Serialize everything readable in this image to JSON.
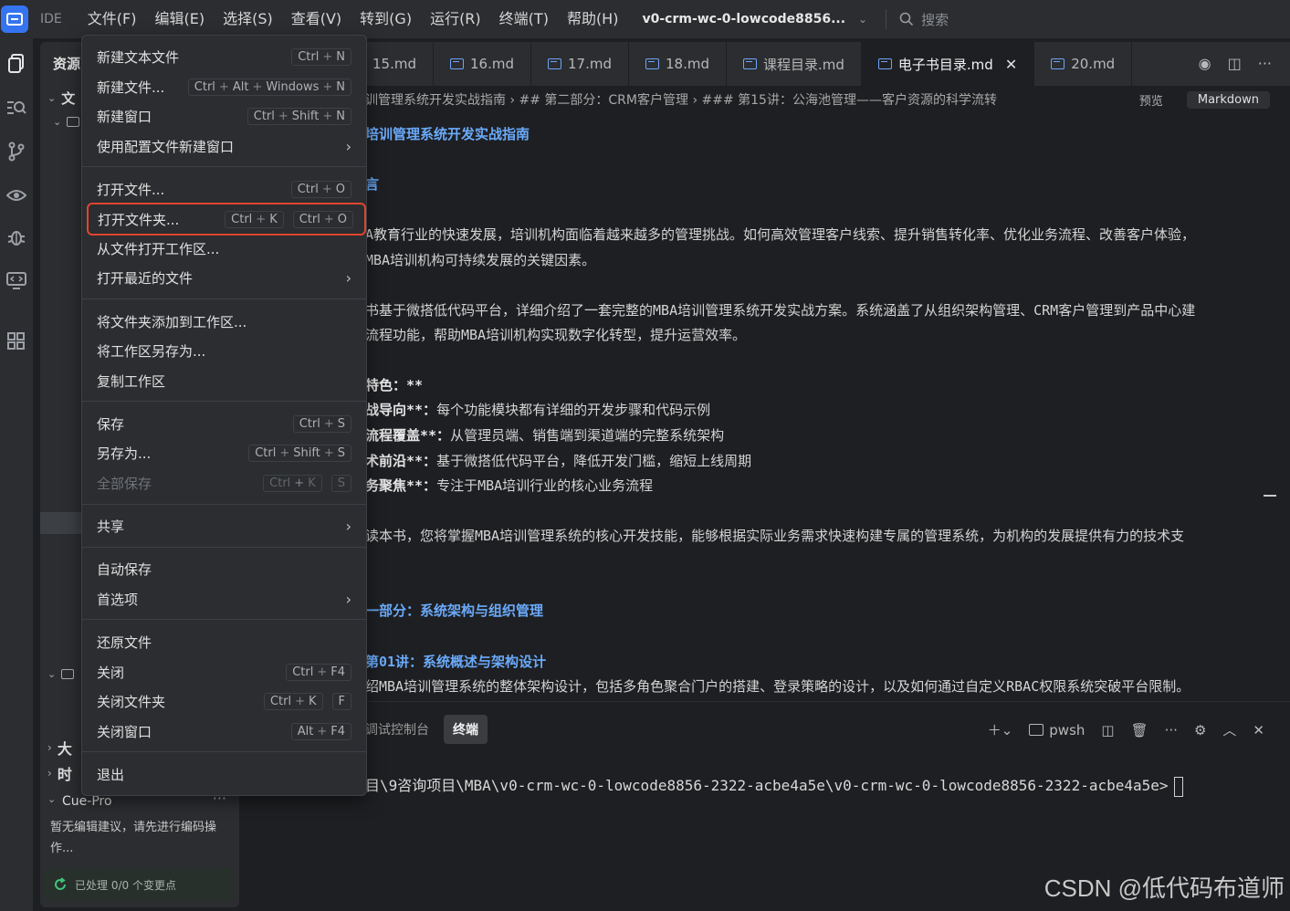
{
  "titlebar": {
    "ide_label": "IDE",
    "menu": [
      "文件(F)",
      "编辑(E)",
      "选择(S)",
      "查看(V)",
      "转到(G)",
      "运行(R)",
      "终端(T)",
      "帮助(H)"
    ],
    "project": "v0-crm-wc-0-lowcode8856...",
    "search_placeholder": "搜索"
  },
  "sidebar": {
    "title": "资源",
    "folder1": "文",
    "row_big": "大",
    "row_time": "时"
  },
  "cue": {
    "title": "Cue-Pro",
    "more": "···",
    "message": "暂无编辑建议，请先进行编码操作...",
    "status": "已处理 0/0 个变更点"
  },
  "tabs": {
    "items": [
      "15.md",
      "16.md",
      "17.md",
      "18.md",
      "课程目录.md",
      "电子书目录.md",
      "20.md"
    ],
    "active_index": 5
  },
  "breadcrumb": {
    "text": "训管理系统开发实战指南 › ## 第二部分：CRM客户管理 › ### 第15讲：公海池管理——客户资源的科学流转",
    "preview_label": "预览",
    "markdown_label": "Markdown"
  },
  "content": {
    "h1": "培训管理系统开发实战指南",
    "h2_intro": "言",
    "p1a": "A教育行业的快速发展，培训机构面临着越来越多的管理挑战。如何高效管理客户线索、提升销售转化率、优化业务流程、改善客户体验，",
    "p1b": "MBA培训机构可持续发展的关键因素。",
    "p2a": "书基于微搭低代码平台，详细介绍了一套完整的MBA培训管理系统开发实战方案。系统涵盖了从组织架构管理、CRM客户管理到产品中心建",
    "p2b": "流程功能，帮助MBA培训机构实现数字化转型，提升运营效率。",
    "features_title": "特色：**",
    "f1_b": "战导向**：",
    "f1": "每个功能模块都有详细的开发步骤和代码示例",
    "f2_b": "流程覆盖**：",
    "f2": "从管理员端、销售端到渠道端的完整系统架构",
    "f3_b": "术前沿**：",
    "f3": "基于微搭低代码平台，降低开发门槛，缩短上线周期",
    "f4_b": "务聚焦**：",
    "f4": "专注于MBA培训行业的核心业务流程",
    "p3": "读本书，您将掌握MBA培训管理系统的核心开发技能，能够根据实际业务需求快速构建专属的管理系统，为机构的发展提供有力的技术支",
    "part1": "一部分：系统架构与组织管理",
    "l01": "第01讲：系统概述与架构设计",
    "l01_desc": "绍MBA培训管理系统的整体架构设计，包括多角色聚合门户的搭建、登录策略的设计，以及如何通过自定义RBAC权限系统突破平台限制。"
  },
  "panel": {
    "tab_debug": "调试控制台",
    "tab_terminal": "终端",
    "shell": "pwsh",
    "terminal_line": "目\\9咨询项目\\MBA\\v0-crm-wc-0-lowcode8856-2322-acbe4a5e\\v0-crm-wc-0-lowcode8856-2322-acbe4a5e>"
  },
  "file_menu": {
    "new_text_file": {
      "label": "新建文本文件",
      "keys": [
        [
          "Ctrl",
          "N"
        ]
      ]
    },
    "new_file": {
      "label": "新建文件...",
      "keys": [
        [
          "Ctrl",
          "Alt",
          "Windows",
          "N"
        ]
      ]
    },
    "new_window": {
      "label": "新建窗口",
      "keys": [
        [
          "Ctrl",
          "Shift",
          "N"
        ]
      ]
    },
    "new_window_profile": {
      "label": "使用配置文件新建窗口"
    },
    "open_file": {
      "label": "打开文件...",
      "keys": [
        [
          "Ctrl",
          "O"
        ]
      ]
    },
    "open_folder": {
      "label": "打开文件夹...",
      "keys": [
        [
          "Ctrl",
          "K"
        ],
        [
          "Ctrl",
          "O"
        ]
      ]
    },
    "open_workspace": {
      "label": "从文件打开工作区..."
    },
    "open_recent": {
      "label": "打开最近的文件"
    },
    "add_folder": {
      "label": "将文件夹添加到工作区..."
    },
    "save_workspace_as": {
      "label": "将工作区另存为..."
    },
    "duplicate_workspace": {
      "label": "复制工作区"
    },
    "save": {
      "label": "保存",
      "keys": [
        [
          "Ctrl",
          "S"
        ]
      ]
    },
    "save_as": {
      "label": "另存为...",
      "keys": [
        [
          "Ctrl",
          "Shift",
          "S"
        ]
      ]
    },
    "save_all": {
      "label": "全部保存",
      "keys": [
        [
          "Ctrl",
          "K"
        ],
        [
          "S"
        ]
      ]
    },
    "share": {
      "label": "共享"
    },
    "auto_save": {
      "label": "自动保存"
    },
    "preferences": {
      "label": "首选项"
    },
    "revert": {
      "label": "还原文件"
    },
    "close": {
      "label": "关闭",
      "keys": [
        [
          "Ctrl",
          "F4"
        ]
      ]
    },
    "close_folder": {
      "label": "关闭文件夹",
      "keys": [
        [
          "Ctrl",
          "K"
        ],
        [
          "F"
        ]
      ]
    },
    "close_window": {
      "label": "关闭窗口",
      "keys": [
        [
          "Alt",
          "F4"
        ]
      ]
    },
    "exit": {
      "label": "退出"
    }
  },
  "watermark": "CSDN @低代码布道师",
  "colors": {
    "accent": "#3574f0",
    "highlight": "#e0452e",
    "heading": "#6aaafa"
  }
}
